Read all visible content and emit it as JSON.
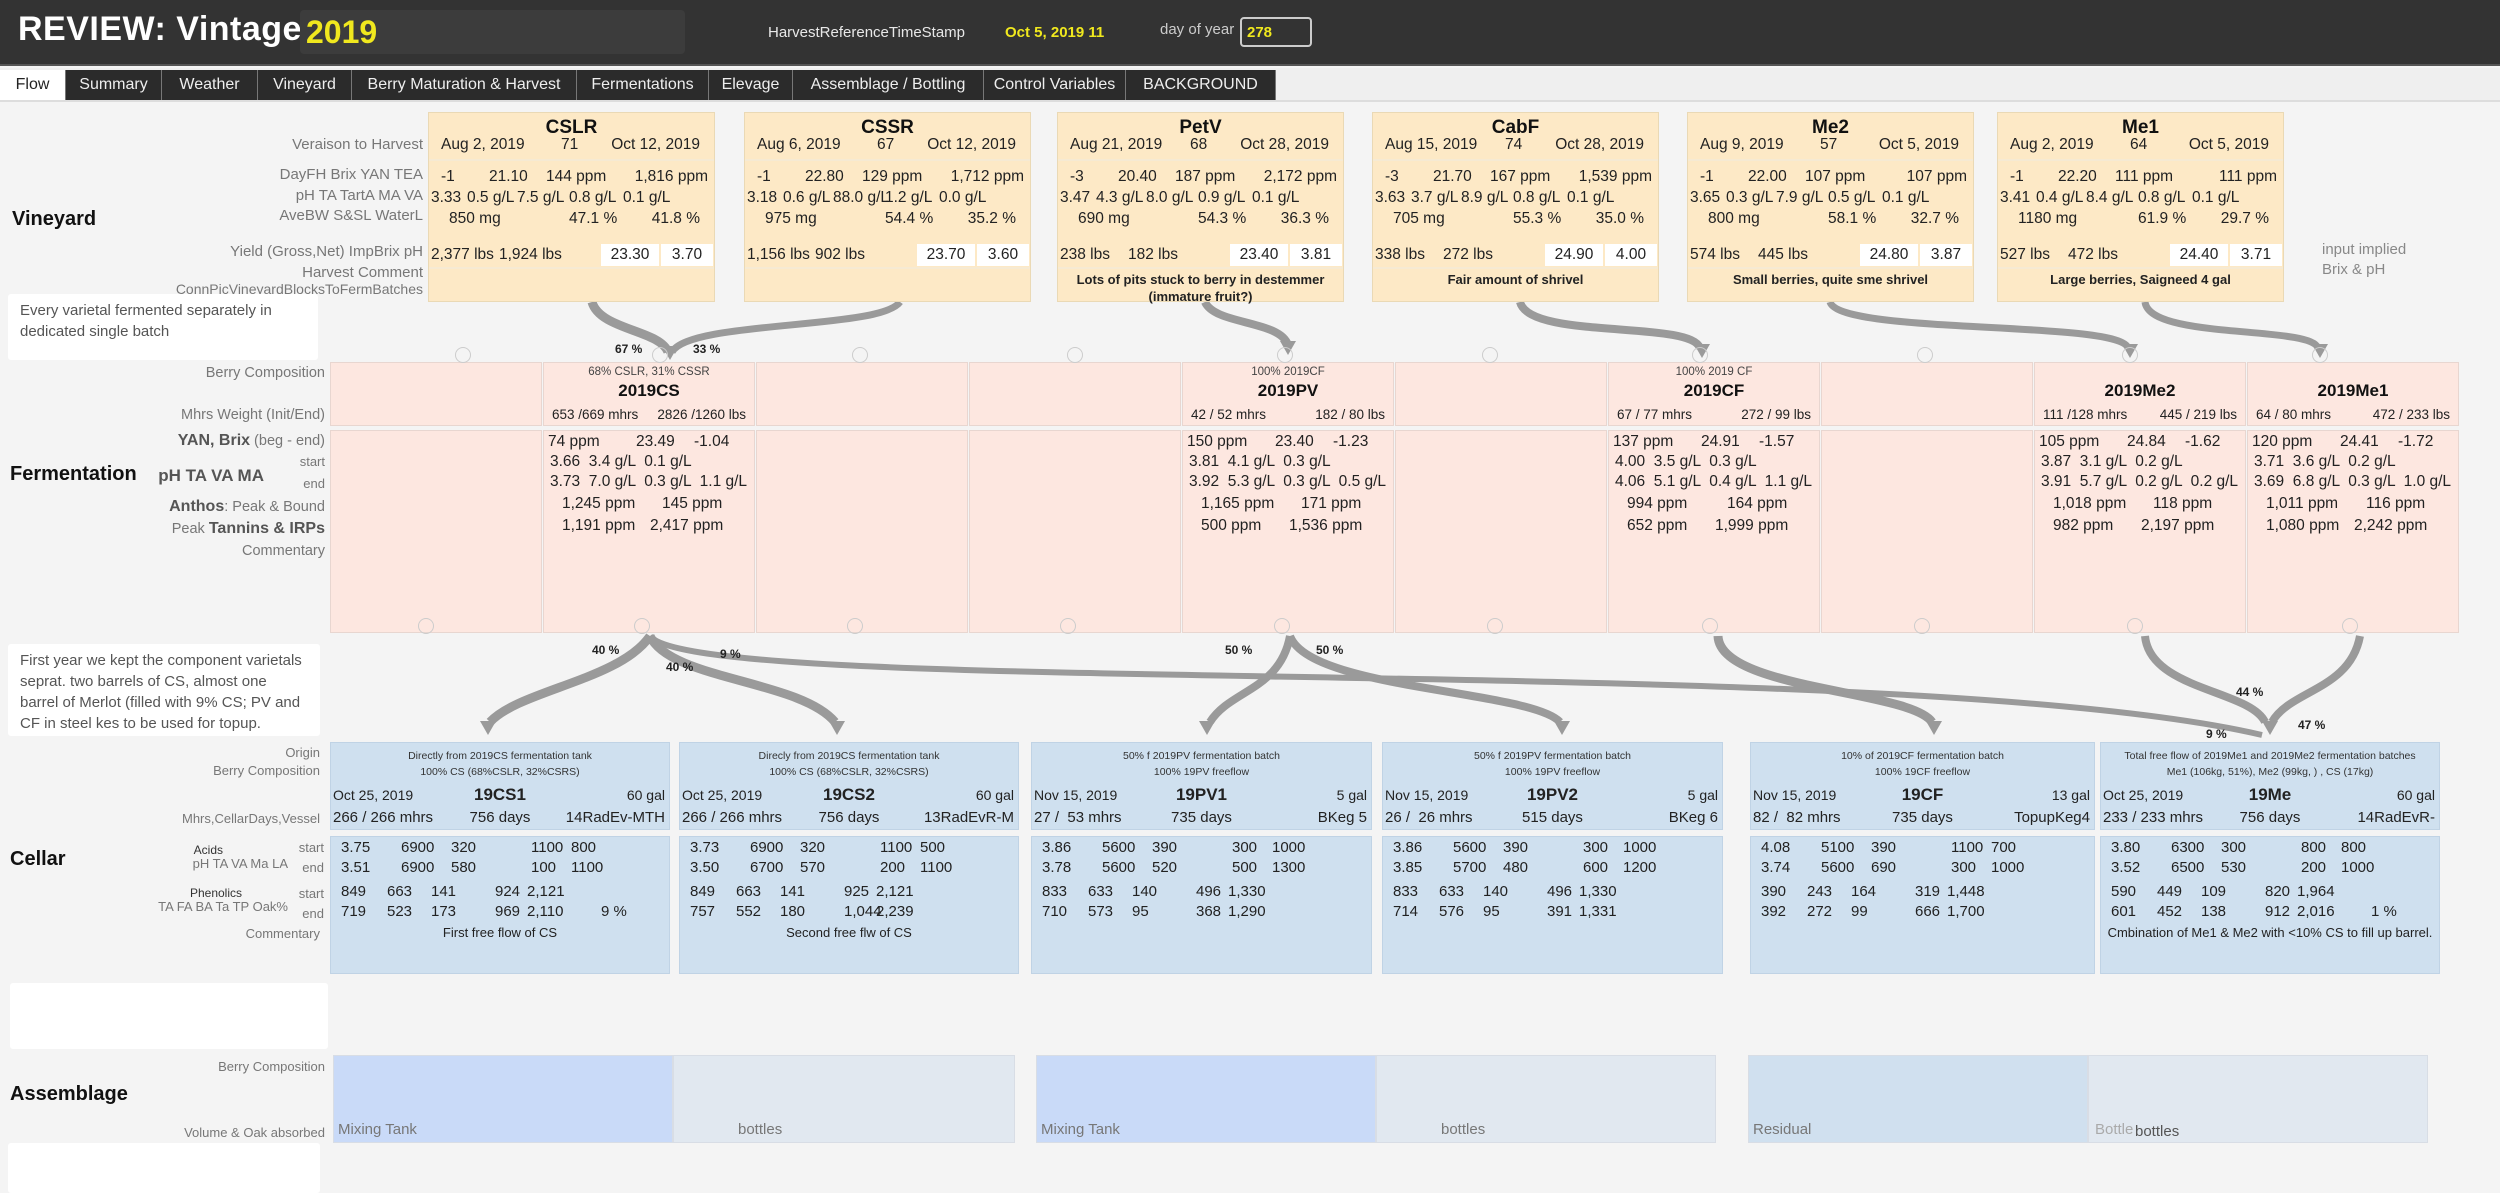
{
  "header": {
    "title": "REVIEW: Vintage",
    "vintage": "2019",
    "harvest_ref_label": "HarvestReferenceTimeStamp",
    "harvest_ref_value": "Oct 5, 2019 11",
    "doy_label": "day of year",
    "doy_value": "278"
  },
  "tabs": [
    "Flow",
    "Summary",
    "Weather",
    "Vineyard",
    "Berry Maturation & Harvest",
    "Fermentations",
    "Elevage",
    "Assemblage / Bottling",
    "Control Variables",
    "BACKGROUND"
  ],
  "active_tab": "Flow",
  "vineyard": {
    "section": "Vineyard",
    "labels": [
      "Veraison to Harvest",
      "DayFH  Brix  YAN  TEA",
      "pH  TA  TartA  MA  VA",
      "AveBW   S&SL   WaterL",
      "Yield (Gross,Net)   ImpBrix pH",
      "Harvest  Comment",
      "ConnPicVineyardBlocksToFermBatches"
    ],
    "note": "Every varietal fermented separately in dedicated single batch",
    "side_note": "input implied Brix & pH",
    "blocks": [
      {
        "name": "CSLR",
        "veraison": "Aug 2, 2019",
        "days": "71",
        "harvest": "Oct 12, 2019",
        "dayfh": "-1",
        "brix": "21.10",
        "yan": "144 ppm",
        "tea": "1,816 ppm",
        "ph": "3.33",
        "ta": "0.5 g/L",
        "tarta": "7.5 g/L",
        "ma": "0.8 g/L",
        "va": "0.1 g/L",
        "avebw": "850 mg",
        "ssl": "47.1 %",
        "waterl": "41.8 %",
        "gross": "2,377 lbs",
        "net": "1,924 lbs",
        "impbrix": "23.30",
        "imph": "3.70",
        "comment": ""
      },
      {
        "name": "CSSR",
        "veraison": "Aug 6, 2019",
        "days": "67",
        "harvest": "Oct 12, 2019",
        "dayfh": "-1",
        "brix": "22.80",
        "yan": "129 ppm",
        "tea": "1,712 ppm",
        "ph": "3.18",
        "ta": "0.6 g/L",
        "tarta": "88.0 g/L",
        "ma": "1.2 g/L",
        "va": "0.0 g/L",
        "avebw": "975 mg",
        "ssl": "54.4 %",
        "waterl": "35.2 %",
        "gross": "1,156 lbs",
        "net": "902 lbs",
        "impbrix": "23.70",
        "imph": "3.60",
        "comment": ""
      },
      {
        "name": "PetV",
        "veraison": "Aug 21, 2019",
        "days": "68",
        "harvest": "Oct 28, 2019",
        "dayfh": "-3",
        "brix": "20.40",
        "yan": "187 ppm",
        "tea": "2,172 ppm",
        "ph": "3.47",
        "ta": "4.3 g/L",
        "tarta": "8.0 g/L",
        "ma": "0.9 g/L",
        "va": "0.1 g/L",
        "avebw": "690 mg",
        "ssl": "54.3 %",
        "waterl": "36.3 %",
        "gross": "238 lbs",
        "net": "182 lbs",
        "impbrix": "23.40",
        "imph": "3.81",
        "comment": "Lots of pits stuck to berry in destemmer (immature fruit?)"
      },
      {
        "name": "CabF",
        "veraison": "Aug 15, 2019",
        "days": "74",
        "harvest": "Oct 28, 2019",
        "dayfh": "-3",
        "brix": "21.70",
        "yan": "167 ppm",
        "tea": "1,539 ppm",
        "ph": "3.63",
        "ta": "3.7 g/L",
        "tarta": "8.9 g/L",
        "ma": "0.8 g/L",
        "va": "0.1 g/L",
        "avebw": "705 mg",
        "ssl": "55.3 %",
        "waterl": "35.0 %",
        "gross": "338 lbs",
        "net": "272 lbs",
        "impbrix": "24.90",
        "imph": "4.00",
        "comment": "Fair amount of shrivel"
      },
      {
        "name": "Me2",
        "veraison": "Aug 9, 2019",
        "days": "57",
        "harvest": "Oct 5, 2019",
        "dayfh": "-1",
        "brix": "22.00",
        "yan": "107 ppm",
        "tea": "107 ppm",
        "ph": "3.65",
        "ta": "0.3 g/L",
        "tarta": "7.9 g/L",
        "ma": "0.5 g/L",
        "va": "0.1 g/L",
        "avebw": "800 mg",
        "ssl": "58.1 %",
        "waterl": "32.7 %",
        "gross": "574 lbs",
        "net": "445 lbs",
        "impbrix": "24.80",
        "imph": "3.87",
        "comment": "Small berries, quite sme shrivel"
      },
      {
        "name": "Me1",
        "veraison": "Aug 2, 2019",
        "days": "64",
        "harvest": "Oct 5, 2019",
        "dayfh": "-1",
        "brix": "22.20",
        "yan": "111 ppm",
        "tea": "111 ppm",
        "ph": "3.41",
        "ta": "0.4 g/L",
        "tarta": "8.4 g/L",
        "ma": "0.8 g/L",
        "va": "0.1 g/L",
        "avebw": "1180 mg",
        "ssl": "61.9 %",
        "waterl": "29.7 %",
        "gross": "527 lbs",
        "net": "472 lbs",
        "impbrix": "24.40",
        "imph": "3.71",
        "comment": "Large berries, Saigneed 4 gal"
      }
    ]
  },
  "vine_to_ferm_pcts": [
    "67 %",
    "33 %"
  ],
  "fermentation": {
    "section": "Fermentation",
    "labels": {
      "berry": "Berry Composition",
      "mhrs": "Mhrs  Weight (Init/End)",
      "yan_a": "YAN, Brix",
      "yan_b": " (beg - end)",
      "ph": "pH  TA  VA  MA",
      "start": "start",
      "end": "end",
      "anthos_a": "Anthos",
      "anthos_b": ": Peak & Bound",
      "tann_a": "Peak ",
      "tann_b": "Tannins & IRPs",
      "commentary": "Commentary"
    },
    "batches": [
      {
        "col": 1,
        "comp": "68% CSLR, 31% CSSR",
        "name": "2019CS",
        "mhrs": "653 /669 mhrs",
        "weight": "2826 /1260 lbs",
        "yan": "74 ppm",
        "brix_beg": "23.49",
        "brix_end": "-1.04",
        "start": "3.66  3.4 g/L  0.1 g/L",
        "end": "3.73  7.0 g/L  0.3 g/L  1.1 g/L",
        "anthos_peak": "1,245 ppm",
        "anthos_bound": "145 ppm",
        "tannins": "1,191 ppm",
        "irps": "2,417 ppm"
      },
      {
        "col": 4,
        "comp": "100% 2019CF",
        "name": "2019PV",
        "mhrs": "42 / 52 mhrs",
        "weight": "182 /   80 lbs",
        "yan": "150 ppm",
        "brix_beg": "23.40",
        "brix_end": "-1.23",
        "start": "3.81  4.1 g/L  0.3 g/L",
        "end": "3.92  5.3 g/L  0.3 g/L  0.5 g/L",
        "anthos_peak": "1,165 ppm",
        "anthos_bound": "171 ppm",
        "tannins": "500 ppm",
        "irps": "1,536 ppm"
      },
      {
        "col": 6,
        "comp": "100% 2019 CF",
        "name": "2019CF",
        "mhrs": "67 / 77 mhrs",
        "weight": "272 /   99 lbs",
        "yan": "137 ppm",
        "brix_beg": "24.91",
        "brix_end": "-1.57",
        "start": "4.00  3.5 g/L  0.3 g/L",
        "end": "4.06  5.1 g/L  0.4 g/L  1.1 g/L",
        "anthos_peak": "994 ppm",
        "anthos_bound": "164 ppm",
        "tannins": "652 ppm",
        "irps": "1,999 ppm"
      },
      {
        "col": 8,
        "comp": "",
        "name": "2019Me2",
        "mhrs": "111 /128 mhrs",
        "weight": "445 /   219 lbs",
        "yan": "105 ppm",
        "brix_beg": "24.84",
        "brix_end": "-1.62",
        "start": "3.87  3.1 g/L  0.2 g/L",
        "end": "3.91  5.7 g/L  0.2 g/L  0.2 g/L",
        "anthos_peak": "1,018 ppm",
        "anthos_bound": "118 ppm",
        "tannins": "982 ppm",
        "irps": "2,197 ppm"
      },
      {
        "col": 9,
        "comp": "",
        "name": "2019Me1",
        "mhrs": "64 / 80 mhrs",
        "weight": "472 /   233 lbs",
        "yan": "120 ppm",
        "brix_beg": "24.41",
        "brix_end": "-1.72",
        "start": "3.71  3.6 g/L  0.2 g/L",
        "end": "3.69  6.8 g/L  0.3 g/L  1.0 g/L",
        "anthos_peak": "1,011 ppm",
        "anthos_bound": "116 ppm",
        "tannins": "1,080 ppm",
        "irps": "2,242 ppm"
      }
    ]
  },
  "ferm_to_cellar_pcts": [
    "40 %",
    "40 %",
    "9 %",
    "50  %",
    "50 %",
    "44  %",
    "47 %",
    "9 %"
  ],
  "cellar": {
    "section": "Cellar",
    "note": "First year we kept the component varietals seprat. two barrels of CS, almost one barrel of Merlot (filled with 9% CS; PV and CF in steel kes to be used for topup.",
    "labels": {
      "origin": "Origin",
      "berry": "Berry Composition",
      "mhrs": "Mhrs,CellarDays,Vessel",
      "acids": "Acids",
      "acids_sub": "pH  TA VA   Ma LA",
      "phenolics": "Phenolics",
      "phen_sub": "TA FA BA    Ta TP     Oak%",
      "start": "start",
      "end": "end",
      "commentary": "Commentary"
    },
    "vessels": [
      {
        "origin": "Directly from 2019CS fermentation tank",
        "comp": "100% CS (68%CSLR, 32%CSRS)",
        "date": "Oct 25, 2019",
        "name": "19CS1",
        "gal": "60 gal",
        "mhrs": "266 / 266 mhrs",
        "days": "756 days",
        "vessel": "14RadEv-MTH",
        "acid_start": [
          "3.75",
          "6900",
          "320",
          "1100",
          "800"
        ],
        "acid_end": [
          "3.51",
          "6900",
          "580",
          "100",
          "1100"
        ],
        "phen_start": [
          "849",
          "663",
          "141",
          "924",
          "2,121",
          ""
        ],
        "phen_end": [
          "719",
          "523",
          "173",
          "969",
          "2,110",
          "9 %"
        ],
        "comment": "First free flow of CS"
      },
      {
        "origin": "Direcly from 2019CS fermentation tank",
        "comp": "100% CS (68%CSLR, 32%CSRS)",
        "date": "Oct 25, 2019",
        "name": "19CS2",
        "gal": "60 gal",
        "mhrs": "266 / 266 mhrs",
        "days": "756 days",
        "vessel": "13RadEvR-M",
        "acid_start": [
          "3.73",
          "6900",
          "320",
          "1100",
          "500"
        ],
        "acid_end": [
          "3.50",
          "6700",
          "570",
          "200",
          "1100"
        ],
        "phen_start": [
          "849",
          "663",
          "141",
          "925",
          "2,121",
          ""
        ],
        "phen_end": [
          "757",
          "552",
          "180",
          "1,044",
          "2,239",
          ""
        ],
        "comment": "Second free flw of CS"
      },
      {
        "origin": "50% f 2019PV fermentation batch",
        "comp": "100% 19PV freeflow",
        "date": "Nov 15, 2019",
        "name": "19PV1",
        "gal": "5 gal",
        "mhrs": "27 /  53 mhrs",
        "days": "735 days",
        "vessel": "BKeg 5",
        "acid_start": [
          "3.86",
          "5600",
          "390",
          "300",
          "1000"
        ],
        "acid_end": [
          "3.78",
          "5600",
          "520",
          "500",
          "1300"
        ],
        "phen_start": [
          "833",
          "633",
          "140",
          "496",
          "1,330",
          ""
        ],
        "phen_end": [
          "710",
          "573",
          "95",
          "368",
          "1,290",
          ""
        ],
        "comment": ""
      },
      {
        "origin": "50% f 2019PV fermentation batch",
        "comp": "100% 19PV freeflow",
        "date": "Nov 15, 2019",
        "name": "19PV2",
        "gal": "5 gal",
        "mhrs": "26 /  26 mhrs",
        "days": "515 days",
        "vessel": "BKeg 6",
        "acid_start": [
          "3.86",
          "5600",
          "390",
          "300",
          "1000"
        ],
        "acid_end": [
          "3.85",
          "5700",
          "480",
          "600",
          "1200"
        ],
        "phen_start": [
          "833",
          "633",
          "140",
          "496",
          "1,330",
          ""
        ],
        "phen_end": [
          "714",
          "576",
          "95",
          "391",
          "1,331",
          ""
        ],
        "comment": ""
      },
      {
        "origin": "10% of 2019CF fermentation batch",
        "comp": "100% 19CF freeflow",
        "date": "Nov 15, 2019",
        "name": "19CF",
        "gal": "13 gal",
        "mhrs": "82 /  82 mhrs",
        "days": "735 days",
        "vessel": "TopupKeg4",
        "acid_start": [
          "4.08",
          "5100",
          "390",
          "1100",
          "700"
        ],
        "acid_end": [
          "3.74",
          "5600",
          "690",
          "300",
          "1000"
        ],
        "phen_start": [
          "390",
          "243",
          "164",
          "319",
          "1,448",
          ""
        ],
        "phen_end": [
          "392",
          "272",
          "99",
          "666",
          "1,700",
          ""
        ],
        "comment": ""
      },
      {
        "origin": "Total free flow of 2019Me1 and 2019Me2 fermentation batches",
        "comp": "Me1 (106kg, 51%), Me2 (99kg, ) , CS (17kg)",
        "date": "Oct 25, 2019",
        "name": "19Me",
        "gal": "60 gal",
        "mhrs": "233 / 233 mhrs",
        "days": "756 days",
        "vessel": "14RadEvR-",
        "acid_start": [
          "3.80",
          "6300",
          "300",
          "800",
          "800"
        ],
        "acid_end": [
          "3.52",
          "6500",
          "530",
          "200",
          "1000"
        ],
        "phen_start": [
          "590",
          "449",
          "109",
          "820",
          "1,964",
          ""
        ],
        "phen_end": [
          "601",
          "452",
          "138",
          "912",
          "2,016",
          "1 %"
        ],
        "comment": "Cmbination of Me1 & Me2 with <10% CS to fill up barrel."
      }
    ]
  },
  "assemblage": {
    "section": "Assemblage",
    "labels": {
      "berry": "Berry Composition",
      "volume": "Volume & Oak absorbed"
    },
    "cells": [
      {
        "label": "Mixing Tank",
        "color": "#c9daf8"
      },
      {
        "label": "bottles",
        "color": "#e1e8f0"
      },
      {
        "label": "Mixing Tank",
        "color": "#c9daf8"
      },
      {
        "label": "bottles",
        "color": "#e1e8f0"
      },
      {
        "label": "Residual",
        "color": "#d0e0ef"
      },
      {
        "label": "Bottle",
        "label2": "bottles",
        "color": "#e1e8f0"
      }
    ]
  },
  "colors": {
    "header_bg": "#333333",
    "accent_yellow": "#f0e81e",
    "vineyard_card": "#fde9c6",
    "ferm_card": "#fde7e0",
    "cellar_card": "#cfe0ef",
    "flow_arrow": "#9a9a9a"
  }
}
